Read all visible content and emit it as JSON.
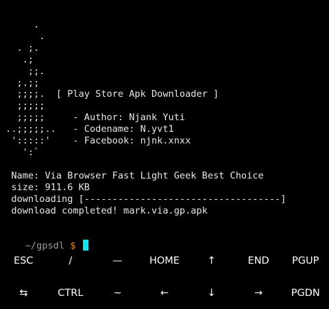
{
  "terminal": {
    "lines": [
      "      .",
      "       .",
      "   . ;.",
      "    .;",
      "     ;;.",
      "   ;.;;",
      "   ;;;;.  [ Play Store Apk Downloader ]",
      "   ;;;;;",
      "   ;;;;;     - Author: Njank Yuti",
      " ..;;;;;..   - Codename: N.yvt1",
      "  ':::::'    - Facebook: njnk.xnxx",
      "    ':`",
      "",
      "  Name: Via Browser Fast Light Geek Best Choice",
      "  size: 911.6 KB",
      "  downloading [-----------------------------------]",
      "  download completed! mark.via.gp.apk"
    ],
    "prompt_path": "~/gpsdl",
    "prompt_symbol": "$"
  },
  "extra_keys": {
    "row1": [
      "ESC",
      "/",
      "—",
      "HOME",
      "↑",
      "END",
      "PGUP"
    ],
    "row2": [
      "⇆",
      "CTRL",
      "~",
      "←",
      "↓",
      "→",
      "PGDN"
    ]
  }
}
